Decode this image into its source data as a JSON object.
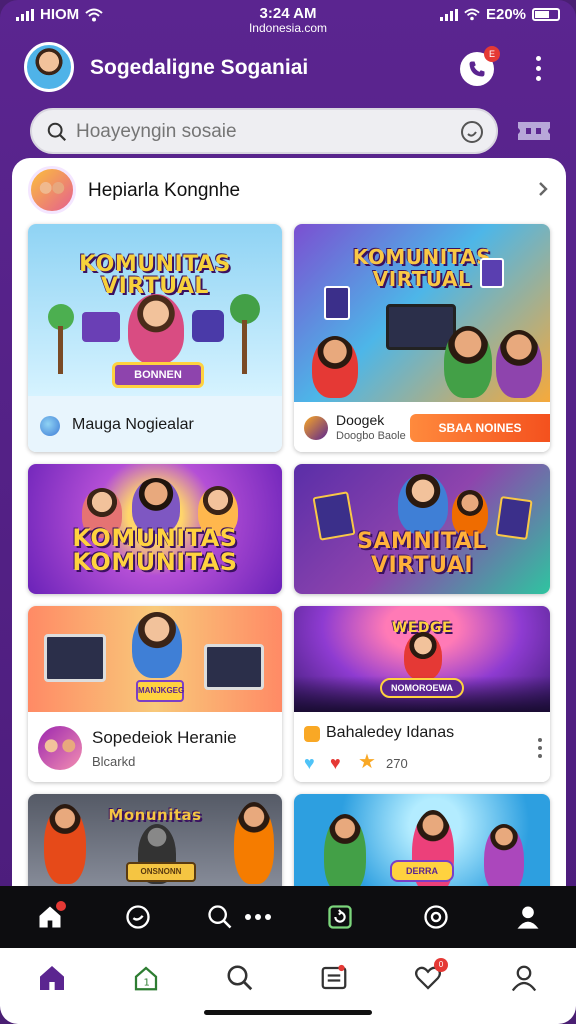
{
  "status_bar": {
    "carrier": "HIOM",
    "time": "3:24 AM",
    "url": "Indonesia.com",
    "battery": "E20%"
  },
  "header": {
    "title": "Sogedaligne Soganiai",
    "call_badge": "E"
  },
  "search": {
    "placeholder": "Hoayeyngin sosaie"
  },
  "section": {
    "title": "Hepiarla Kongnhe"
  },
  "cards": [
    {
      "art_title": "KOMUNITAS VIRTUAL",
      "button": "BONNEN",
      "footer_text": "Mauga Nogiealar",
      "colors": {
        "bg1": "#8fd3f4",
        "bg2": "#c9f0ff",
        "title": "#f7d13b"
      }
    },
    {
      "art_title": "KOMUNITAS VIRTUAL",
      "footer_text": "Doogek",
      "footer_sub": "Doogbo Baole",
      "button": "SBAA NOINES",
      "colors": {
        "bg1": "#7b4fd1",
        "bg2": "#f6a93b",
        "title": "#f9c846"
      }
    },
    {
      "art_title": "KOMUNITAS KOMUNITAS",
      "colors": {
        "bg1": "#7a2ec9",
        "bg2": "#f0a037",
        "title": "#ffd23f"
      }
    },
    {
      "art_title": "SAMNITAL VIRTUAI",
      "colors": {
        "bg1": "#5a2ea8",
        "bg2": "#2fc4a0",
        "title": "#ffb13b"
      }
    },
    {
      "art_title": "",
      "badge_text": "MANJKGEG",
      "footer_text": "Sopedeiok Heranie",
      "footer_sub": "Blcarkd",
      "colors": {
        "bg1": "#f8c97a",
        "bg2": "#ff8a65",
        "title": "#7b3fc6"
      }
    },
    {
      "art_title": "WEDGE",
      "badge_text": "NOMOROEWA",
      "footer_text": "Bahaledey Idanas",
      "footer_sub": "270",
      "colors": {
        "bg1": "#5b2aa6",
        "bg2": "#e64b8c",
        "title": "#ffd23f"
      }
    },
    {
      "art_title": "Monunitas",
      "badge_text": "ONSNONN",
      "colors": {
        "bg1": "#555a66",
        "bg2": "#8a8f9c",
        "title": "#f5c542"
      }
    },
    {
      "art_title": "",
      "badge_text": "DERRA",
      "colors": {
        "bg1": "#2d9fe0",
        "bg2": "#7ed3f7",
        "title": "#ff7043"
      }
    }
  ],
  "nav_dark": [
    {
      "icon": "home-icon",
      "active": true
    },
    {
      "icon": "chat-icon"
    },
    {
      "icon": "search-icon"
    },
    {
      "icon": "more-dots-icon"
    },
    {
      "icon": "refresh-icon"
    },
    {
      "icon": "settings-icon"
    },
    {
      "icon": "profile-icon"
    }
  ],
  "nav_light": [
    {
      "icon": "home-icon",
      "active": true
    },
    {
      "icon": "shield-icon"
    },
    {
      "icon": "search-icon"
    },
    {
      "icon": "news-icon"
    },
    {
      "icon": "heart-icon",
      "badge": "0"
    },
    {
      "icon": "profile-icon"
    }
  ],
  "accent": "#5b2590"
}
